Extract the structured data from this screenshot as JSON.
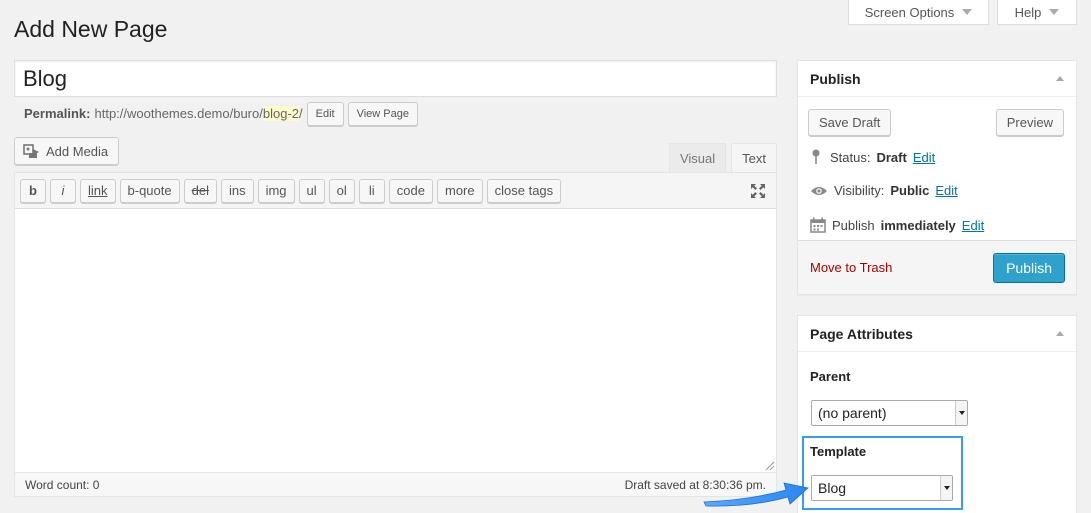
{
  "header": {
    "screen_options_label": "Screen Options",
    "help_label": "Help",
    "page_title": "Add New Page"
  },
  "post": {
    "title_value": "Blog",
    "permalink_label": "Permalink:",
    "permalink_base": "http://woothemes.demo/buro/",
    "permalink_slug": "blog-2",
    "permalink_trailing": "/",
    "edit_label": "Edit",
    "view_page_label": "View Page"
  },
  "editor": {
    "add_media_label": "Add Media",
    "tabs": [
      "Visual",
      "Text"
    ],
    "active_tab": "Text",
    "quicktags": [
      "b",
      "i",
      "link",
      "b-quote",
      "del",
      "ins",
      "img",
      "ul",
      "ol",
      "li",
      "code",
      "more",
      "close tags"
    ],
    "content": "",
    "word_count": "Word count: 0",
    "draft_saved": "Draft saved at 8:30:36 pm."
  },
  "publish": {
    "title": "Publish",
    "save_draft_label": "Save Draft",
    "preview_label": "Preview",
    "status_label": "Status:",
    "status_value": "Draft",
    "visibility_label": "Visibility:",
    "visibility_value": "Public",
    "publish_label": "Publish",
    "publish_when": "immediately",
    "edit_link": "Edit",
    "trash_label": "Move to Trash",
    "publish_button": "Publish"
  },
  "attributes": {
    "title": "Page Attributes",
    "parent_label": "Parent",
    "parent_value": "(no parent)",
    "template_label": "Template",
    "template_value": "Blog"
  },
  "colors": {
    "accent": "#2ea2cc",
    "link": "#0073aa",
    "danger": "#a00",
    "annotation": "#3b99fc"
  }
}
